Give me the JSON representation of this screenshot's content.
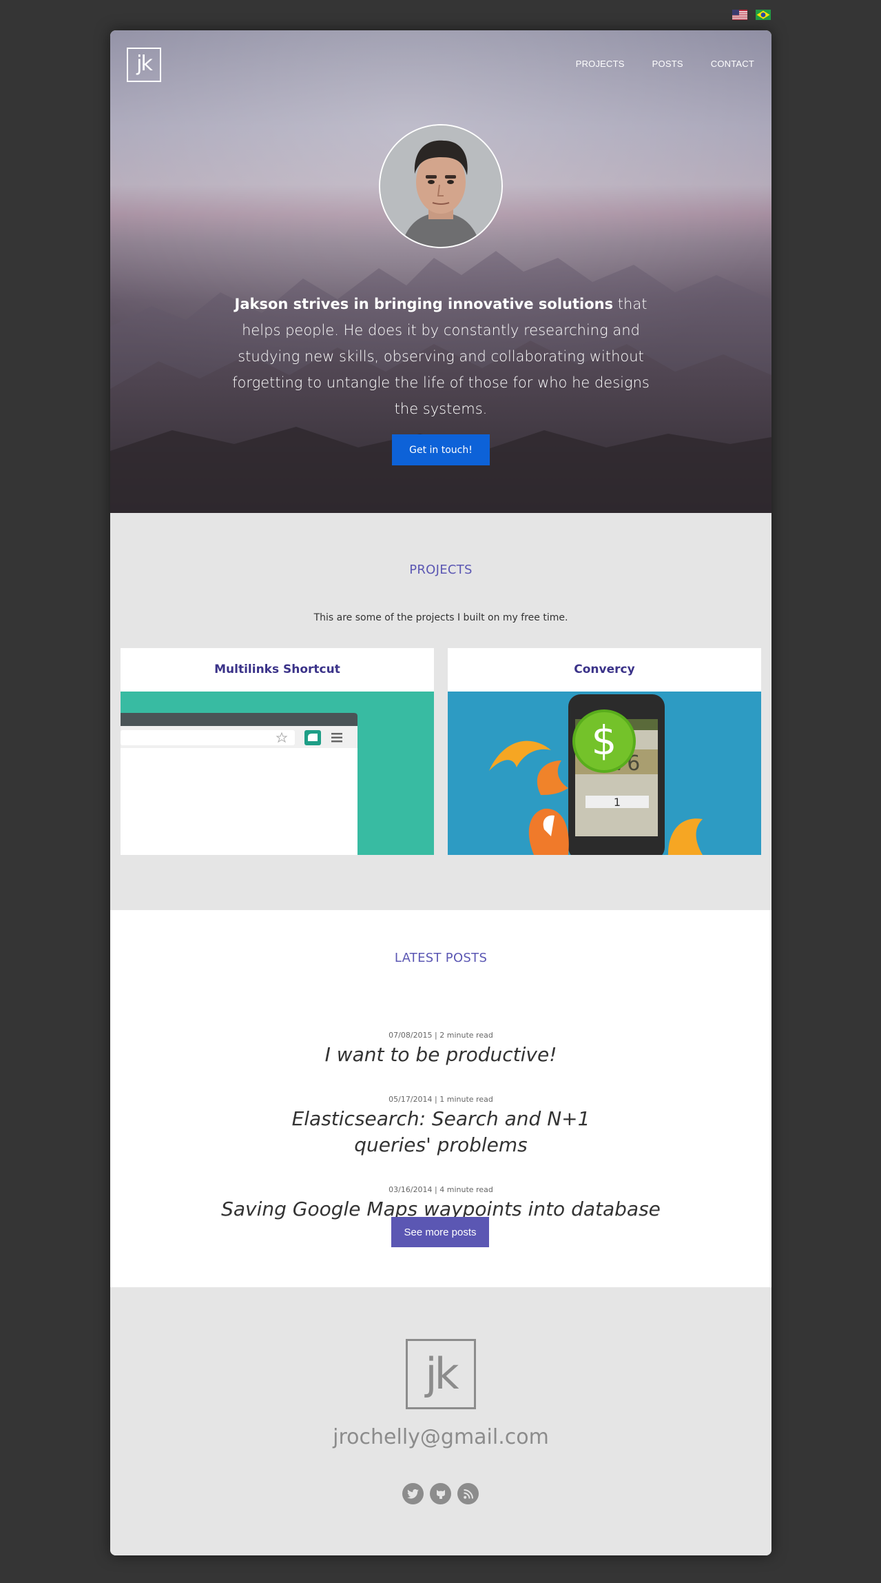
{
  "languages": [
    {
      "name": "us-flag-icon"
    },
    {
      "name": "brazil-flag-icon"
    }
  ],
  "header": {
    "logo_text": "jk",
    "nav": [
      "PROJECTS",
      "POSTS",
      "CONTACT"
    ]
  },
  "hero": {
    "tagline_bold": "Jakson strives in bringing innovative solutions",
    "tagline_rest": " that helps people. He does it by constantly researching and studying new skills, observing and collaborating without forgetting to untangle the life of those for who he designs the systems.",
    "cta_label": "Get in touch!"
  },
  "projects": {
    "title": "PROJECTS",
    "intro": "This are some of the projects I built on my free time.",
    "items": [
      {
        "title": "Multilinks Shortcut"
      },
      {
        "title": "Convercy",
        "phone_value": "0.76",
        "phone_input": "1"
      }
    ]
  },
  "posts": {
    "title": "LATEST POSTS",
    "items": [
      {
        "meta": "07/08/2015 | 2 minute read",
        "title": "I want to be productive!"
      },
      {
        "meta": "05/17/2014 | 1 minute read",
        "title": "Elasticsearch: Search and N+1 queries' problems"
      },
      {
        "meta": "03/16/2014 | 4 minute read",
        "title": "Saving Google Maps waypoints into database"
      }
    ],
    "more_label": "See more posts"
  },
  "footer": {
    "logo_text": "jk",
    "email": "jrochelly@gmail.com",
    "socials": [
      "twitter-icon",
      "github-icon",
      "rss-icon"
    ]
  },
  "colors": {
    "background": "#353535",
    "accent": "#5b57b3",
    "cta": "#0d62d8",
    "project_title": "#3b3389"
  }
}
